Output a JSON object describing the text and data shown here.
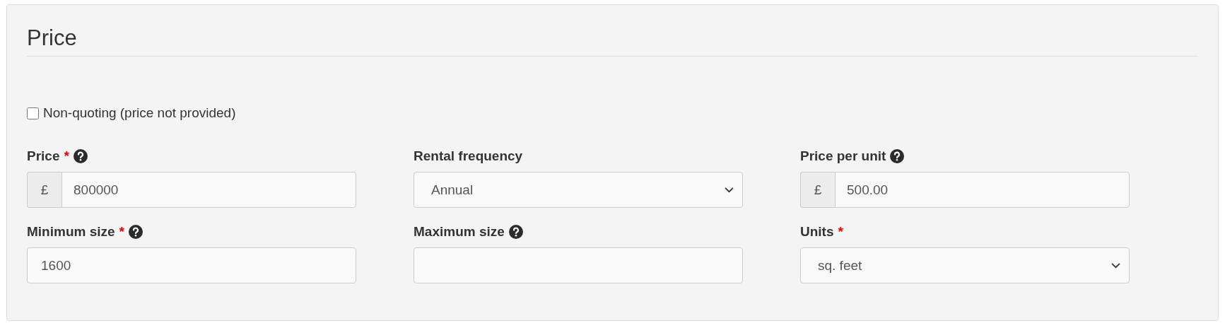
{
  "section": {
    "title": "Price"
  },
  "non_quoting": {
    "label": "Non-quoting (price not provided)",
    "checked": false
  },
  "fields": [
    {
      "label": "Price",
      "required_mark": "*",
      "help": true,
      "kind": "addon",
      "prefix": "£",
      "value": "800000"
    },
    {
      "label": "Rental frequency",
      "help": false,
      "kind": "select",
      "value": "Annual"
    },
    {
      "label": "Price per unit",
      "help": true,
      "kind": "addon",
      "prefix": "£",
      "value": "500.00"
    },
    {
      "label": "Minimum size",
      "required_mark": "*",
      "help": true,
      "kind": "input",
      "value": "1600"
    },
    {
      "label": "Maximum size",
      "help": true,
      "kind": "input"
    },
    {
      "label": "Units",
      "required_mark": "*",
      "help": false,
      "kind": "select",
      "value": "sq. feet"
    }
  ]
}
